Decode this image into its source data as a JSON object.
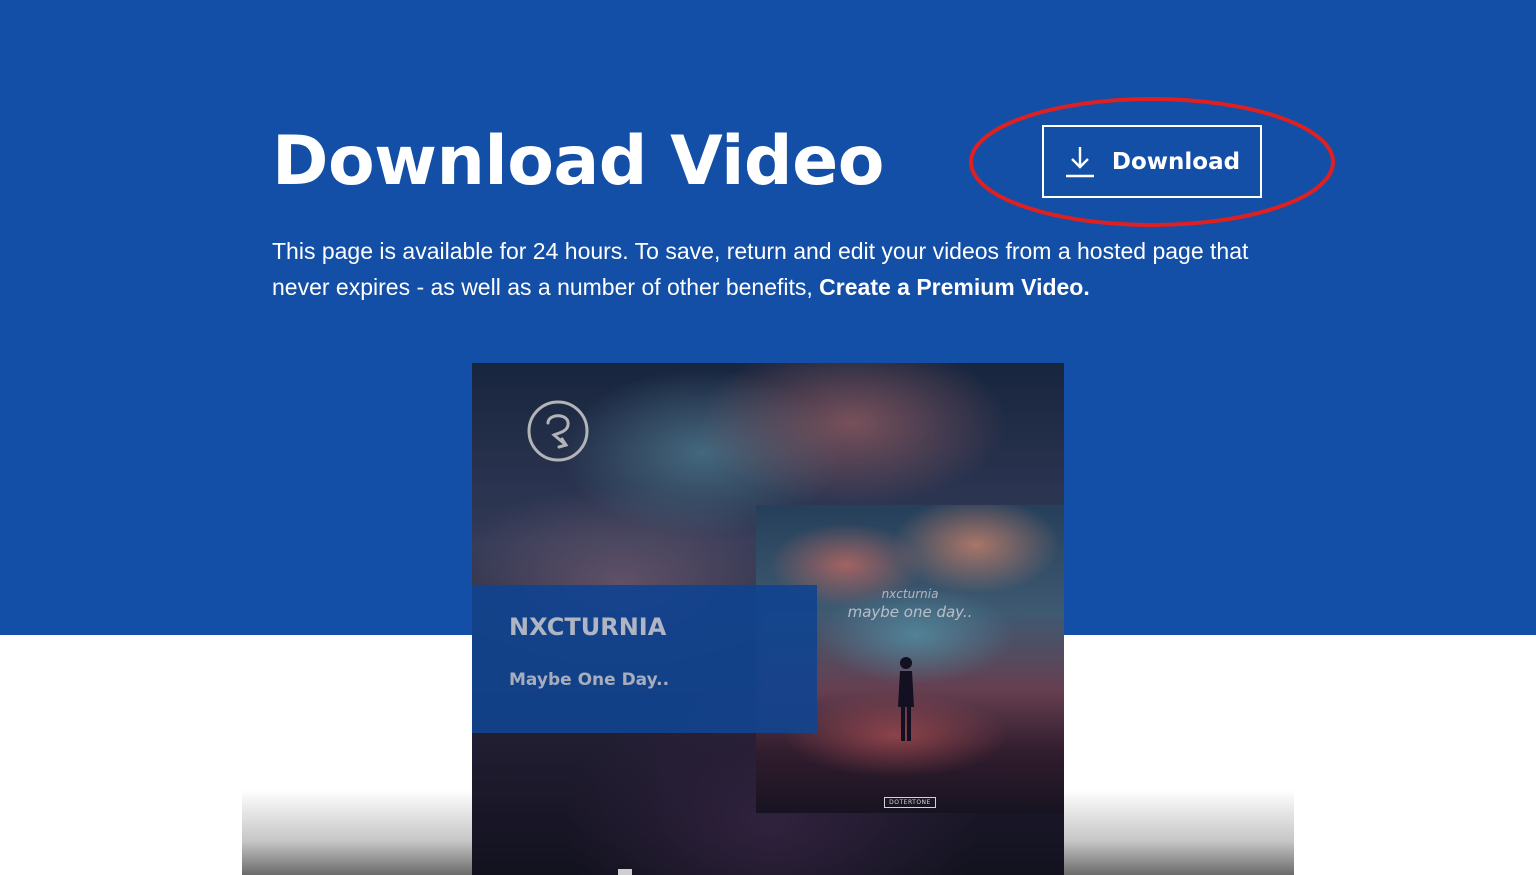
{
  "header": {
    "title": "Download Video",
    "download_label": "Download",
    "intro_text": "This page is available for 24 hours. To save, return and edit your videos from a hosted page that never expires - as well as a number of other benefits, ",
    "intro_link": "Create a Premium Video."
  },
  "video": {
    "artist": "NXCTURNIA",
    "track": "Maybe One Day..",
    "cover_artist": "nxcturnia",
    "cover_track": "maybe one day..",
    "cover_label": "DOTERTONE"
  },
  "colors": {
    "brand_blue": "#134fa6",
    "highlight_red": "#e02020",
    "text_white": "#ffffff"
  },
  "icons": {
    "download": "download-arrow-icon",
    "video_logo": "circle-r-logo"
  }
}
